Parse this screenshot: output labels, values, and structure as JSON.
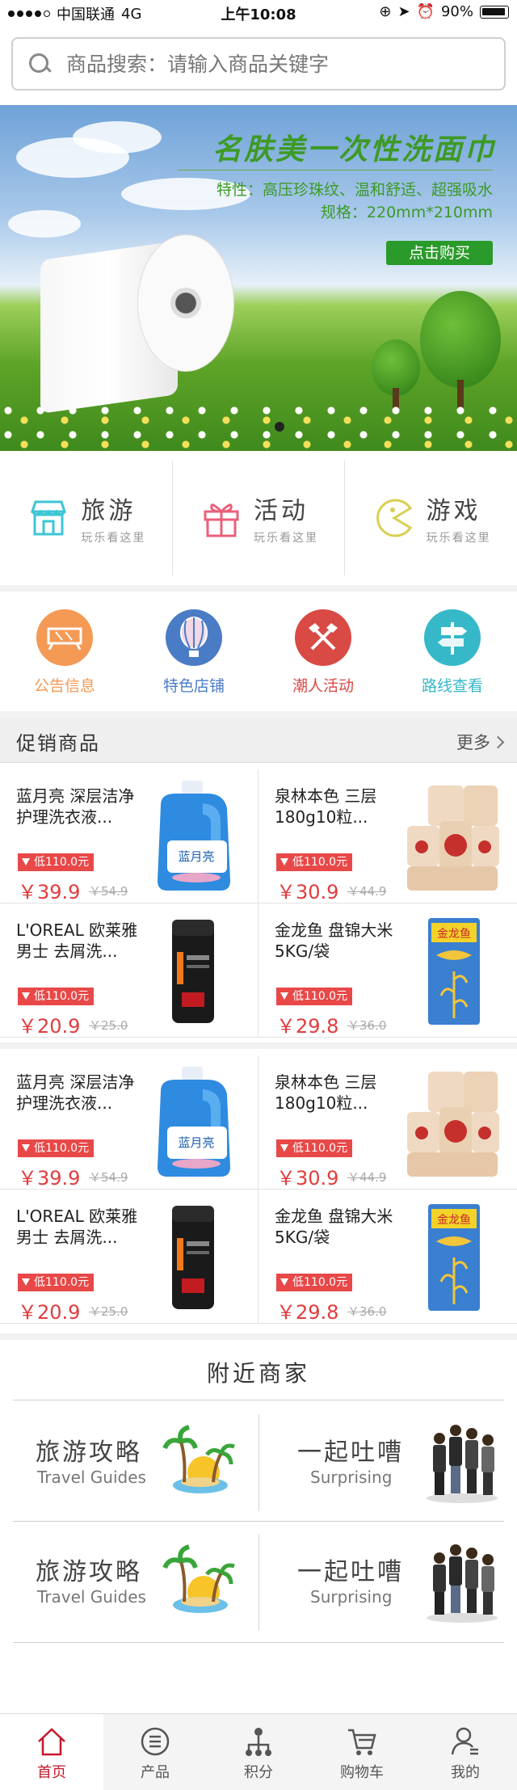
{
  "status_bar": {
    "carrier": "中国联通",
    "network": "4G",
    "time": "上午10:08",
    "battery": "90%"
  },
  "search": {
    "placeholder": "商品搜索：请输入商品关键字"
  },
  "banner": {
    "title": "名肤美一次性洗面巾",
    "features": "特性：高压珍珠纹、温和舒适、超强吸水",
    "spec": "规格：220mm*210mm",
    "buy_label": "点击购买"
  },
  "categories": [
    {
      "title": "旅游",
      "sub": "玩乐看这里",
      "icon": "shop-icon",
      "color": "#3cc6d6"
    },
    {
      "title": "活动",
      "sub": "玩乐看这里",
      "icon": "gift-icon",
      "color": "#e9607a"
    },
    {
      "title": "游戏",
      "sub": "玩乐看这里",
      "icon": "pacman-icon",
      "color": "#d9cf52"
    }
  ],
  "infos": [
    {
      "label": "公告信息",
      "color": "#f49a55",
      "icon": "notice-icon"
    },
    {
      "label": "特色店铺",
      "color": "#4a7cc6",
      "icon": "balloon-icon"
    },
    {
      "label": "潮人活动",
      "color": "#d94a44",
      "icon": "crossed-axes-icon"
    },
    {
      "label": "路线查看",
      "color": "#36b8c8",
      "icon": "signpost-icon"
    }
  ],
  "promo": {
    "title": "促销商品",
    "more": "更多"
  },
  "products_a": [
    {
      "name": "蓝月亮 深层洁净护理洗衣液...",
      "tag": "低110.0元",
      "price": "￥39.9",
      "old": "￥54.9",
      "img": "detergent"
    },
    {
      "name": "泉林本色 三层180g10粒...",
      "tag": "低110.0元",
      "price": "￥30.9",
      "old": "￥44.9",
      "img": "tissue"
    },
    {
      "name": "L'OREAL 欧莱雅男士 去屑洗...",
      "tag": "低110.0元",
      "price": "￥20.9",
      "old": "￥25.0",
      "img": "shampoo"
    },
    {
      "name": "金龙鱼 盘锦大米 5KG/袋",
      "tag": "低110.0元",
      "price": "￥29.8",
      "old": "￥36.0",
      "img": "rice"
    }
  ],
  "products_b": [
    {
      "name": "蓝月亮 深层洁净护理洗衣液...",
      "tag": "低110.0元",
      "price": "￥39.9",
      "old": "￥54.9",
      "img": "detergent"
    },
    {
      "name": "泉林本色 三层180g10粒...",
      "tag": "低110.0元",
      "price": "￥30.9",
      "old": "￥44.9",
      "img": "tissue"
    },
    {
      "name": "L'OREAL 欧莱雅男士 去屑洗...",
      "tag": "低110.0元",
      "price": "￥20.9",
      "old": "￥25.0",
      "img": "shampoo"
    },
    {
      "name": "金龙鱼 盘锦大米 5KG/袋",
      "tag": "低110.0元",
      "price": "￥29.8",
      "old": "￥36.0",
      "img": "rice"
    }
  ],
  "nearby": {
    "title": "附近商家",
    "items": [
      {
        "t1": "旅游攻略",
        "t2": "Travel Guides",
        "icon": "palm-island-icon"
      },
      {
        "t1": "一起吐嘈",
        "t2": "Surprising",
        "icon": "people-group-icon"
      },
      {
        "t1": "旅游攻略",
        "t2": "Travel Guides",
        "icon": "palm-island-icon"
      },
      {
        "t1": "一起吐嘈",
        "t2": "Surprising",
        "icon": "people-group-icon"
      }
    ]
  },
  "tabs": [
    {
      "label": "首页",
      "icon": "home-icon",
      "active": true
    },
    {
      "label": "产品",
      "icon": "list-icon",
      "active": false
    },
    {
      "label": "积分",
      "icon": "points-icon",
      "active": false
    },
    {
      "label": "购物车",
      "icon": "cart-icon",
      "active": false
    },
    {
      "label": "我的",
      "icon": "user-icon",
      "active": false
    }
  ],
  "colors": {
    "accent": "#c4192b",
    "price": "#e23c3c",
    "banner_green": "#3d9a25"
  }
}
